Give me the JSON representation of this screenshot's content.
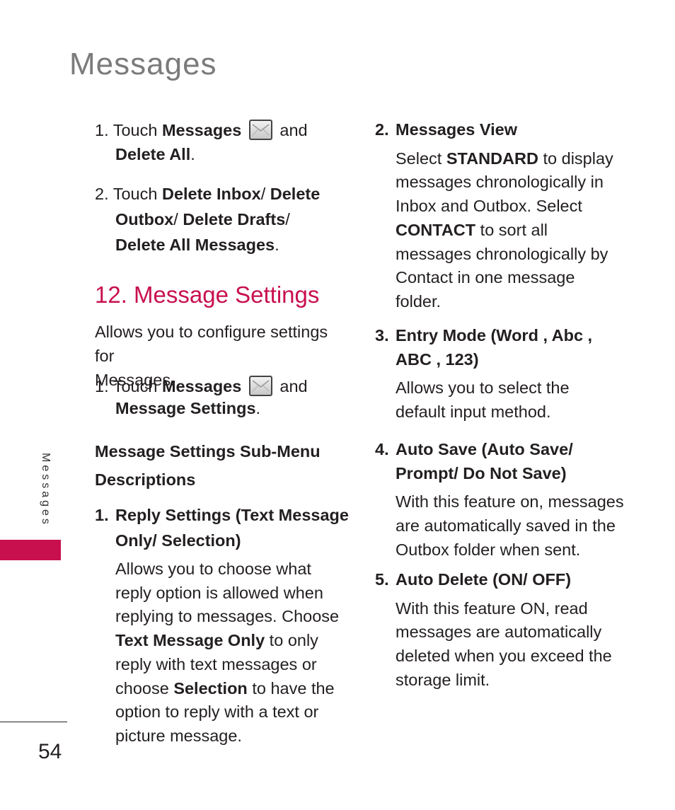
{
  "header": {
    "title": "Messages"
  },
  "left_column": {
    "delete_steps": [
      {
        "num": "1.",
        "parts": [
          "Touch ",
          "Messages",
          " and",
          "Delete All",
          "."
        ]
      },
      {
        "num": "2.",
        "line1_pre": "Touch ",
        "line1_b1": "Delete Inbox",
        "line1_sep": "/ ",
        "line1_b2": "Delete",
        "line2_b1": "Outbox",
        "line2_sep1": "/ ",
        "line2_b2": "Delete Drafts",
        "line2_sep2": "/",
        "line3_b": "Delete All Messages",
        "line3_end": "."
      }
    ],
    "section_title": "12. Message Settings",
    "intro_line1": "Allows you to configure settings for",
    "intro_line2": "Messages.",
    "settings_step": {
      "num": "1.",
      "pre": "Touch ",
      "b1": "Messages",
      "post": " and",
      "b2": "Message Settings",
      "end": "."
    },
    "submenu_heading_line1": "Message Settings Sub-Menu",
    "submenu_heading_line2": "Descriptions",
    "item1": {
      "num": "1.",
      "title_line1": "Reply Settings (Text Message",
      "title_line2": "Only/ Selection)",
      "desc": {
        "l1": "Allows you to choose what",
        "l2": "reply option is allowed when",
        "l3": "replying to messages. Choose",
        "l4_b": "Text Message Only",
        "l4_post": " to only",
        "l5": "reply with text messages or",
        "l6_pre": "choose ",
        "l6_b": "Selection",
        "l6_post": " to have the",
        "l7": "option to reply with a text or",
        "l8": "picture message."
      }
    }
  },
  "right_column": {
    "item2": {
      "num": "2.",
      "title": "Messages View",
      "l1_pre": "Select ",
      "l1_b": "STANDARD",
      "l1_post": " to display",
      "l2": "messages chronologically in",
      "l3": "Inbox and Outbox. Select",
      "l4_b": "CONTACT",
      "l4_post": " to sort all",
      "l5": "messages chronologically by",
      "l6": "Contact in one message",
      "l7": "folder."
    },
    "item3": {
      "num": "3.",
      "title_line1": "Entry Mode (Word , Abc ,",
      "title_line2": "ABC , 123)",
      "l1": "Allows you to select the",
      "l2": "default input method."
    },
    "item4": {
      "num": "4.",
      "title_line1": "Auto Save (Auto Save/",
      "title_line2": "Prompt/ Do Not Save)",
      "l1": "With this feature on, messages",
      "l2": "are automatically saved in the",
      "l3": "Outbox folder when sent."
    },
    "item5": {
      "num": "5.",
      "title": "Auto Delete (ON/ OFF)",
      "l1": "With this feature ON, read",
      "l2": "messages are automatically",
      "l3": "deleted when you exceed the",
      "l4": "storage limit."
    }
  },
  "sidebar": {
    "label": "Messages",
    "accent_color": "#c8104e"
  },
  "footer": {
    "page_number": "54"
  },
  "icons": {
    "messages": "envelope-icon"
  }
}
